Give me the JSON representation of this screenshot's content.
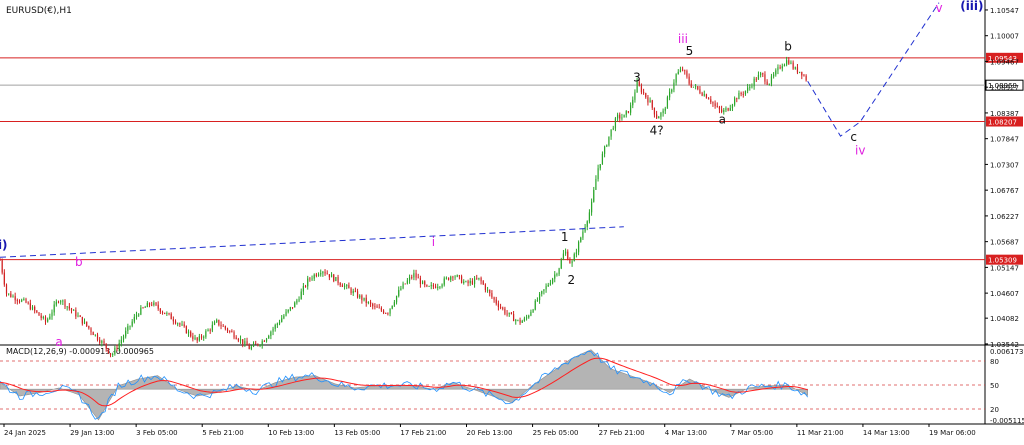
{
  "symbol_label": "EURUSD(€),H1",
  "colors": {
    "background": "#ffffff",
    "grid": "#c0c0c0",
    "bull_candle": "#2aa52a",
    "bear_candle": "#d02020",
    "resistance_line": "#d82020",
    "trend_dash": "#2030d0",
    "wave_magenta": "#e020e0",
    "wave_blue": "#1818b0",
    "macd_hist": "#b4b4b4",
    "macd_line": "#1e90ff",
    "signal_line": "#ff2020",
    "level_dash": "#d84040"
  },
  "chart_data": [
    {
      "type": "candlestick",
      "symbol": "EURUSD(€),H1",
      "ylim": [
        1.0354,
        1.1063
      ],
      "y_ticks": [
        "1.10547",
        "1.10007",
        "1.09467",
        "1.08927",
        "1.08387",
        "1.07847",
        "1.07307",
        "1.06767",
        "1.06227",
        "1.05687",
        "1.05147",
        "1.04607",
        "1.04082",
        "1.03542"
      ],
      "x_ticks": [
        "24 Jan 2025",
        "29 Jan 13:00",
        "3 Feb 05:00",
        "5 Feb 21:00",
        "10 Feb 13:00",
        "13 Feb 05:00",
        "17 Feb 21:00",
        "20 Feb 13:00",
        "25 Feb 05:00",
        "27 Feb 21:00",
        "4 Mar 13:00",
        "7 Mar 05:00",
        "11 Mar 21:00",
        "14 Mar 13:00",
        "19 Mar 06:00"
      ],
      "price_path": [
        [
          0,
          1.053
        ],
        [
          1,
          1.046
        ],
        [
          4,
          1.044
        ],
        [
          7,
          1.04
        ],
        [
          9,
          1.045
        ],
        [
          12,
          1.041
        ],
        [
          14,
          1.038
        ],
        [
          16,
          1.035
        ],
        [
          17,
          1.033
        ],
        [
          21,
          1.042
        ],
        [
          23,
          1.044
        ],
        [
          27,
          1.04
        ],
        [
          30,
          1.036
        ],
        [
          33,
          1.04
        ],
        [
          36,
          1.037
        ],
        [
          38,
          1.0345
        ],
        [
          40,
          1.036
        ],
        [
          43,
          1.041
        ],
        [
          45,
          1.044
        ],
        [
          47,
          1.049
        ],
        [
          49,
          1.051
        ],
        [
          52,
          1.048
        ],
        [
          54,
          1.046
        ],
        [
          57,
          1.043
        ],
        [
          59,
          1.042
        ],
        [
          61,
          1.047
        ],
        [
          63,
          1.05
        ],
        [
          65,
          1.047
        ],
        [
          67,
          1.048
        ],
        [
          69,
          1.05
        ],
        [
          71,
          1.048
        ],
        [
          73,
          1.049
        ],
        [
          75,
          1.045
        ],
        [
          77,
          1.042
        ],
        [
          79,
          1.04
        ],
        [
          80,
          1.0405
        ],
        [
          82,
          1.045
        ],
        [
          84,
          1.049
        ],
        [
          85,
          1.051
        ],
        [
          86,
          1.055
        ],
        [
          87,
          1.052
        ],
        [
          89,
          1.06
        ],
        [
          90,
          1.064
        ],
        [
          91,
          1.072
        ],
        [
          92,
          1.076
        ],
        [
          93,
          1.08
        ],
        [
          94,
          1.083
        ],
        [
          95,
          1.083
        ],
        [
          96,
          1.085
        ],
        [
          97,
          1.09
        ],
        [
          98,
          1.088
        ],
        [
          99,
          1.086
        ],
        [
          100,
          1.083
        ],
        [
          101,
          1.084
        ],
        [
          102,
          1.088
        ],
        [
          103,
          1.092
        ],
        [
          104,
          1.093
        ],
        [
          105,
          1.09
        ],
        [
          106,
          1.089
        ],
        [
          107,
          1.088
        ],
        [
          108,
          1.087
        ],
        [
          109,
          1.085
        ],
        [
          110,
          1.084
        ],
        [
          111,
          1.085
        ],
        [
          112,
          1.087
        ],
        [
          113,
          1.088
        ],
        [
          114,
          1.089
        ],
        [
          115,
          1.091
        ],
        [
          116,
          1.092
        ],
        [
          117,
          1.09
        ],
        [
          118,
          1.092
        ],
        [
          119,
          1.094
        ],
        [
          120,
          1.095
        ],
        [
          121,
          1.093
        ],
        [
          122,
          1.0925
        ],
        [
          123,
          1.0905
        ]
      ],
      "price_ticks": [
        1.10547,
        1.10007,
        1.09467,
        1.08927,
        1.08387,
        1.07847,
        1.07307,
        1.06767,
        1.06227,
        1.05687,
        1.05147,
        1.04607,
        1.04082,
        1.03542
      ],
      "horizontal_levels": [
        {
          "price": 1.09543,
          "label": "1.09543",
          "color": "#d82020"
        },
        {
          "price": 1.08207,
          "label": "1.08207",
          "color": "#d82020"
        },
        {
          "price": 1.05309,
          "label": "1.05309",
          "color": "#d82020"
        }
      ],
      "current_price": {
        "price": 1.08969,
        "label": "1.08969"
      },
      "projection": [
        [
          123,
          1.0905
        ],
        [
          128,
          1.079
        ],
        [
          131,
          1.082
        ],
        [
          143,
          1.107
        ]
      ],
      "trendline": [
        [
          0,
          1.0536
        ],
        [
          95,
          1.06
        ]
      ],
      "wave_labels": [
        {
          "text": "(i)",
          "x": 0,
          "price": 1.0553,
          "color": "#1818b0"
        },
        {
          "text": "b",
          "x": 12,
          "price": 1.0518,
          "color": "#e020e0"
        },
        {
          "text": "a",
          "x": 9,
          "price": 1.035,
          "color": "#e020e0"
        },
        {
          "text": "i",
          "x": 66,
          "price": 1.056,
          "color": "#e020e0"
        },
        {
          "text": "1",
          "x": 86,
          "price": 1.057,
          "color": "#111111"
        },
        {
          "text": "2",
          "x": 87,
          "price": 1.048,
          "color": "#111111"
        },
        {
          "text": "3",
          "x": 97,
          "price": 1.0905,
          "color": "#111111"
        },
        {
          "text": "4?",
          "x": 100,
          "price": 1.0793,
          "color": "#111111"
        },
        {
          "text": "iii",
          "x": 104,
          "price": 1.0985,
          "color": "#e020e0"
        },
        {
          "text": "5",
          "x": 105,
          "price": 1.096,
          "color": "#111111"
        },
        {
          "text": "a",
          "x": 110,
          "price": 1.0817,
          "color": "#111111"
        },
        {
          "text": "b",
          "x": 120,
          "price": 1.097,
          "color": "#111111"
        },
        {
          "text": "c",
          "x": 130,
          "price": 1.078,
          "color": "#111111"
        },
        {
          "text": "iv",
          "x": 131,
          "price": 1.0752,
          "color": "#e020e0"
        },
        {
          "text": "v",
          "x": 143,
          "price": 1.105,
          "color": "#e020e0"
        },
        {
          "text": "(iii)",
          "x": 148,
          "price": 1.1055,
          "color": "#1818b0"
        }
      ]
    },
    {
      "type": "line",
      "name": "MACD(12,26,9) -0.000913 -0.000965",
      "label": "MACD(12,26,9) -0.000913 -0.000965",
      "ylim": [
        -0.0051,
        0.0062
      ],
      "y_ticks": [
        "0.006173",
        "80",
        "50",
        "20",
        "-0.005115"
      ],
      "levels": [
        {
          "value": 80
        },
        {
          "value": 50
        },
        {
          "value": 20
        }
      ],
      "macd_points": [
        [
          0,
          0.001
        ],
        [
          3,
          -0.001
        ],
        [
          6,
          -0.0005
        ],
        [
          9,
          0.0002
        ],
        [
          12,
          -0.0008
        ],
        [
          15,
          -0.0045
        ],
        [
          18,
          0.0005
        ],
        [
          21,
          0.0015
        ],
        [
          24,
          0.002
        ],
        [
          27,
          0.0
        ],
        [
          30,
          -0.001
        ],
        [
          33,
          -0.0005
        ],
        [
          36,
          0.0005
        ],
        [
          39,
          -0.0002
        ],
        [
          42,
          0.001
        ],
        [
          45,
          0.0018
        ],
        [
          48,
          0.002
        ],
        [
          51,
          0.0008
        ],
        [
          54,
          0.0002
        ],
        [
          57,
          0.0005
        ],
        [
          60,
          0.0006
        ],
        [
          63,
          0.0005
        ],
        [
          66,
          0.0
        ],
        [
          69,
          0.001
        ],
        [
          72,
          0.0
        ],
        [
          75,
          -0.001
        ],
        [
          78,
          -0.002
        ],
        [
          81,
          0.0005
        ],
        [
          84,
          0.0025
        ],
        [
          87,
          0.0045
        ],
        [
          90,
          0.0058
        ],
        [
          93,
          0.003
        ],
        [
          96,
          0.002
        ],
        [
          99,
          0.001
        ],
        [
          102,
          -0.0005
        ],
        [
          105,
          0.0015
        ],
        [
          108,
          0.0
        ],
        [
          111,
          -0.0012
        ],
        [
          114,
          0.0002
        ],
        [
          117,
          0.0005
        ],
        [
          120,
          0.0006
        ],
        [
          123,
          -0.0009
        ]
      ]
    }
  ]
}
